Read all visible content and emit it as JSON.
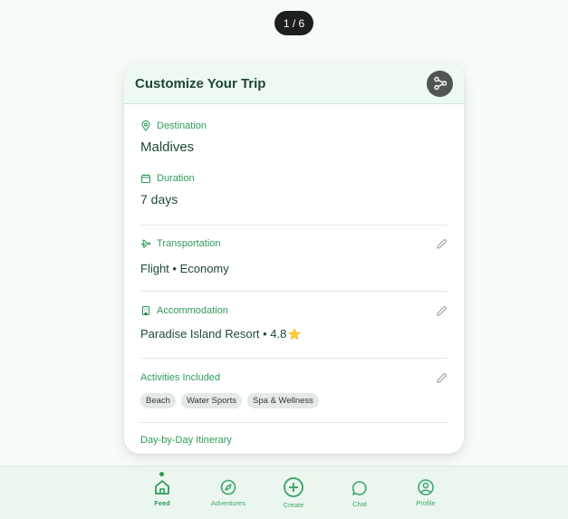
{
  "pager": {
    "text": "1 / 6"
  },
  "card": {
    "title": "Customize Your Trip",
    "destination": {
      "label": "Destination",
      "value": "Maldives"
    },
    "duration": {
      "label": "Duration",
      "value": "7 days"
    },
    "transportation": {
      "label": "Transportation",
      "value": "Flight • Economy"
    },
    "accommodation": {
      "label": "Accommodation",
      "value": "Paradise Island Resort • 4.8",
      "rating_icon": "star-icon"
    },
    "activities": {
      "label": "Activities Included",
      "chips": [
        "Beach",
        "Water Sports",
        "Spa & Wellness"
      ]
    },
    "itinerary": {
      "label": "Day-by-Day Itinerary"
    }
  },
  "nav": {
    "items": [
      {
        "label": "Feed",
        "icon": "home-icon",
        "active": true
      },
      {
        "label": "Adventures",
        "icon": "compass-icon"
      },
      {
        "label": "Create",
        "icon": "plus-circle-icon"
      },
      {
        "label": "Chat",
        "icon": "chat-bubble-icon"
      },
      {
        "label": "Profile",
        "icon": "profile-icon"
      }
    ]
  },
  "colors": {
    "accent": "#2e9b59",
    "text": "#1e4a34",
    "header_bg": "#eefaf1"
  }
}
